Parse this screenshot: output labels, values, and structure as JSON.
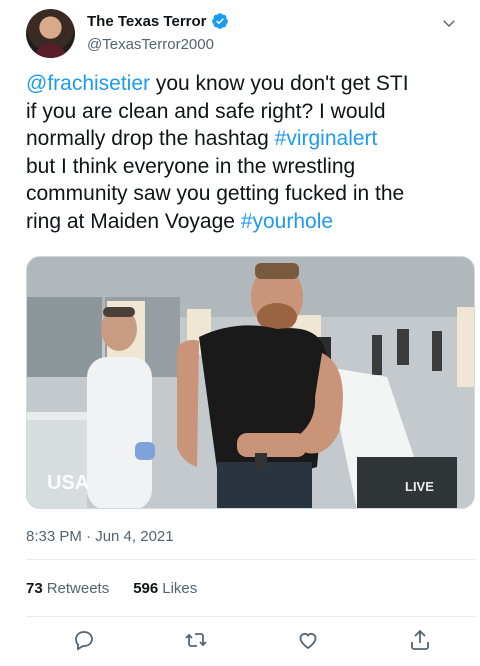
{
  "user": {
    "display_name": "The Texas Terror",
    "handle": "@TexasTerror2000"
  },
  "tweet": {
    "lines": [
      [
        {
          "text": "@frachisetier",
          "link": true
        },
        {
          "text": " you know you don't get STI",
          "link": false
        }
      ],
      [
        {
          "text": "if you are clean and safe right? I would",
          "link": false
        }
      ],
      [
        {
          "text": "normally drop the hashtag ",
          "link": false
        },
        {
          "text": "#virginalert",
          "link": true
        }
      ],
      [
        {
          "text": "but I think everyone in the wrestling",
          "link": false
        }
      ],
      [
        {
          "text": "community saw you getting fucked in the",
          "link": false
        }
      ],
      [
        {
          "text": "ring at Maiden Voyage ",
          "link": false
        },
        {
          "text": "#yourhole",
          "link": true
        }
      ]
    ]
  },
  "media": {
    "network_logo": "USA",
    "live_badge": "LIVE"
  },
  "timestamp": "8:33 PM · Jun 4, 2021",
  "stats": {
    "retweets_count": "73",
    "retweets_label": "Retweets",
    "likes_count": "596",
    "likes_label": "Likes"
  },
  "icons": {
    "verified": "verified-badge-icon",
    "more": "chevron-down-icon",
    "reply": "reply-icon",
    "retweet": "retweet-icon",
    "like": "heart-icon",
    "share": "share-icon"
  },
  "colors": {
    "link": "#1d9bf0",
    "secondary_text": "#536471",
    "primary_text": "#0f1419"
  }
}
